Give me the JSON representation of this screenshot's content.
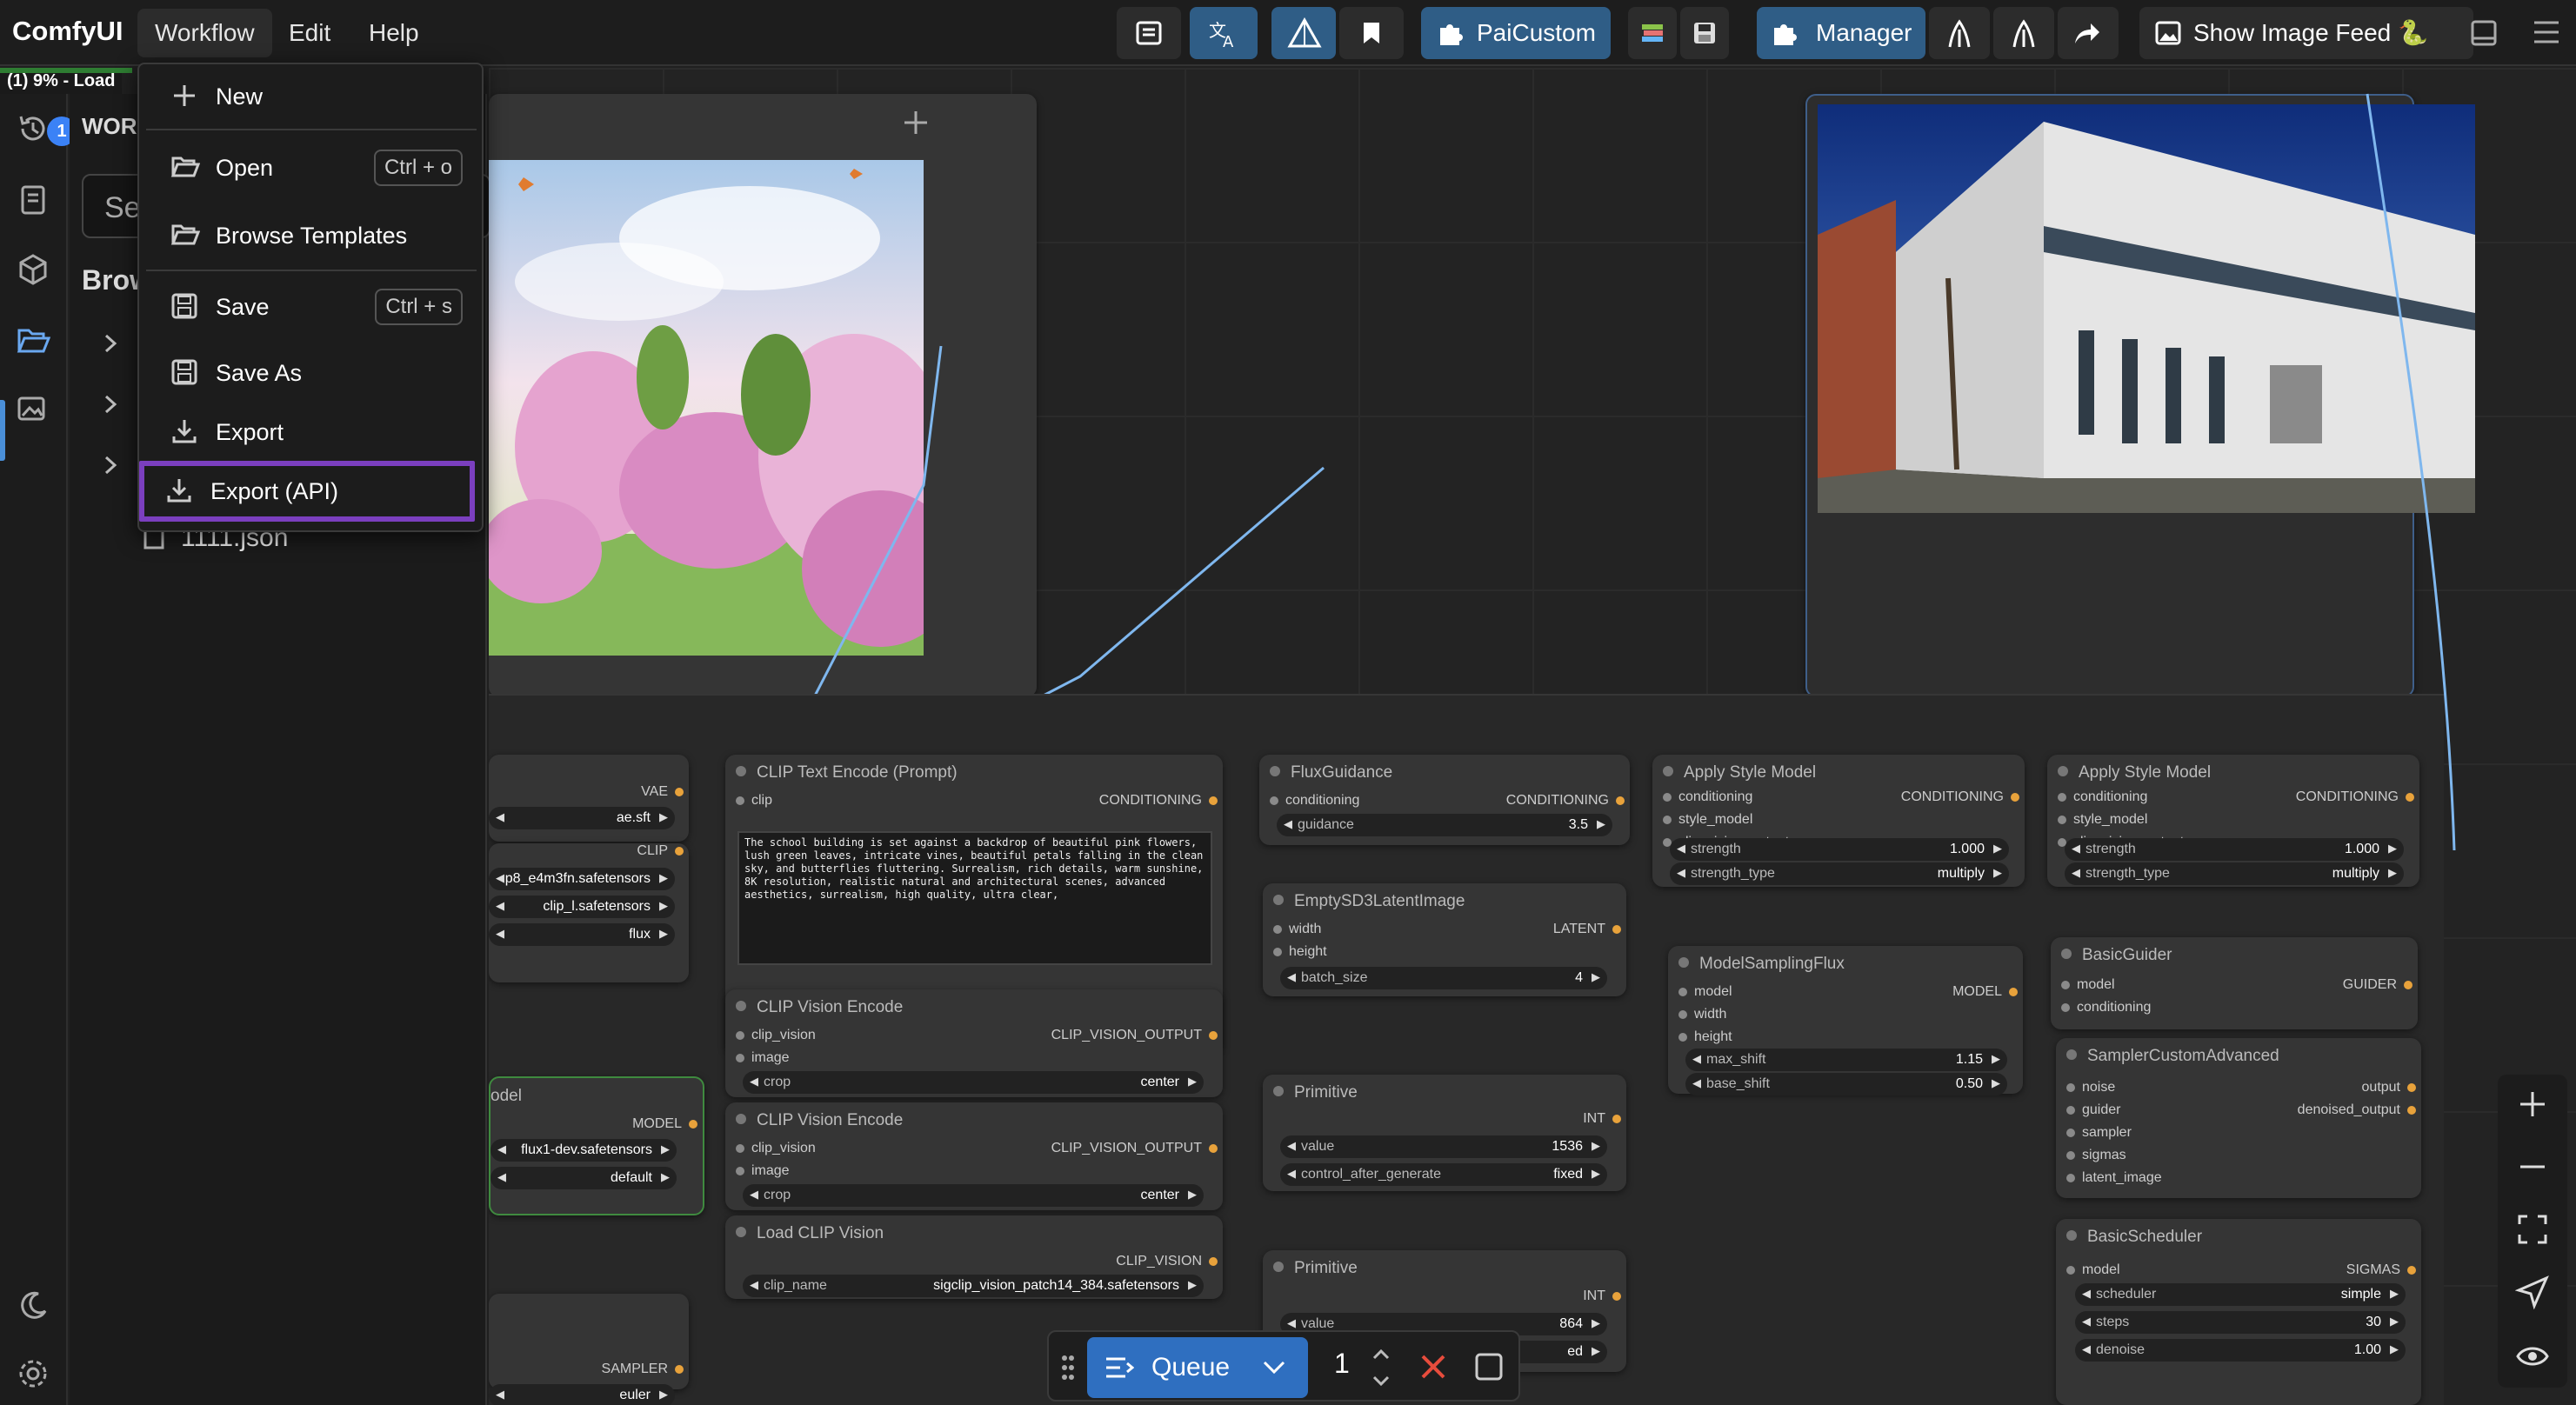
{
  "app": {
    "logo": "ComfyUI"
  },
  "menubar": {
    "workflow": "Workflow",
    "edit": "Edit",
    "help": "Help"
  },
  "toolbar": {
    "paicustom": "PaiCustom",
    "manager": "Manager",
    "show_image_feed": "Show Image Feed 🐍"
  },
  "status": {
    "load": "(1) 9% - Load"
  },
  "sidebar": {
    "queue_badge": "1",
    "panel_title": "WORK",
    "search_placeholder": "Se",
    "browse": "Brow",
    "file": "1111.json"
  },
  "workflow_menu": {
    "items": [
      {
        "label": "New",
        "shortcut": ""
      },
      {
        "label": "Open",
        "shortcut": "Ctrl + o"
      },
      {
        "label": "Browse Templates",
        "shortcut": ""
      },
      {
        "label": "Save",
        "shortcut": "Ctrl + s"
      },
      {
        "label": "Save As",
        "shortcut": ""
      },
      {
        "label": "Export",
        "shortcut": ""
      },
      {
        "label": "Export (API)",
        "shortcut": ""
      }
    ]
  },
  "nodes": {
    "vae_loader": {
      "slot_vae": "VAE",
      "vae_name": "ae.sft"
    },
    "clip_loader": {
      "slot_clip": "CLIP",
      "clip1": "p8_e4m3fn.safetensors",
      "clip2": "clip_l.safetensors",
      "type": "flux"
    },
    "unet_loader": {
      "title_frag": "odel",
      "slot_model": "MODEL",
      "unet": "flux1-dev.safetensors",
      "dtype": "default"
    },
    "sampler_select": {
      "slot_sampler": "SAMPLER",
      "sampler": "euler"
    },
    "clip_text_encode": {
      "title": "CLIP Text Encode (Prompt)",
      "in_clip": "clip",
      "out": "CONDITIONING",
      "text": "The school building is set against a backdrop of beautiful pink flowers, lush green leaves, intricate vines, beautiful petals falling in the clean sky, and butterflies fluttering. Surrealism, rich details, warm sunshine, 8K resolution, realistic natural and architectural scenes, advanced aesthetics, surrealism, high quality, ultra clear,"
    },
    "clip_vision_encode_1": {
      "title": "CLIP Vision Encode",
      "in1": "clip_vision",
      "in2": "image",
      "out": "CLIP_VISION_OUTPUT",
      "crop_label": "crop",
      "crop": "center"
    },
    "clip_vision_encode_2": {
      "title": "CLIP Vision Encode",
      "in1": "clip_vision",
      "in2": "image",
      "out": "CLIP_VISION_OUTPUT",
      "crop_label": "crop",
      "crop": "center"
    },
    "load_clip_vision": {
      "title": "Load CLIP Vision",
      "out": "CLIP_VISION",
      "label": "clip_name",
      "value": "sigclip_vision_patch14_384.safetensors"
    },
    "flux_guidance": {
      "title": "FluxGuidance",
      "in": "conditioning",
      "out": "CONDITIONING",
      "label": "guidance",
      "value": "3.5"
    },
    "empty_latent": {
      "title": "EmptySD3LatentImage",
      "in1": "width",
      "in2": "height",
      "out": "LATENT",
      "label": "batch_size",
      "value": "4"
    },
    "primitive_1": {
      "title": "Primitive",
      "out": "INT",
      "l1": "value",
      "v1": "1536",
      "l2": "control_after_generate",
      "v2": "fixed"
    },
    "primitive_2": {
      "title": "Primitive",
      "out": "INT",
      "l1": "value",
      "v1": "864",
      "v2_frag": "ed"
    },
    "apply_style_1": {
      "title": "Apply Style Model",
      "in1": "conditioning",
      "in2": "style_model",
      "in3": "clip_vision_output",
      "out": "CONDITIONING",
      "l1": "strength",
      "v1": "1.000",
      "l2": "strength_type",
      "v2": "multiply"
    },
    "apply_style_2": {
      "title": "Apply Style Model",
      "in1": "conditioning",
      "in2": "style_model",
      "in3": "clip_vision_output",
      "out": "CONDITIONING",
      "l1": "strength",
      "v1": "1.000",
      "l2": "strength_type",
      "v2": "multiply"
    },
    "model_sampling_flux": {
      "title": "ModelSamplingFlux",
      "in1": "model",
      "in2": "width",
      "in3": "height",
      "out": "MODEL",
      "l1": "max_shift",
      "v1": "1.15",
      "l2": "base_shift",
      "v2": "0.50"
    },
    "basic_guider": {
      "title": "BasicGuider",
      "in1": "model",
      "in2": "conditioning",
      "out": "GUIDER"
    },
    "sampler_custom_adv": {
      "title": "SamplerCustomAdvanced",
      "in1": "noise",
      "in2": "guider",
      "in3": "sampler",
      "in4": "sigmas",
      "in5": "latent_image",
      "out1": "output",
      "out2": "denoised_output"
    },
    "basic_scheduler": {
      "title": "BasicScheduler",
      "in1": "model",
      "out": "SIGMAS",
      "l1": "scheduler",
      "v1": "simple",
      "l2": "steps",
      "v2": "30",
      "l3": "denoise",
      "v3": "1.00"
    }
  },
  "queue": {
    "label": "Queue",
    "count": "1"
  },
  "colors": {
    "accent": "#2f6fc0",
    "highlight_border": "#7b3fbf",
    "panel": "#353535",
    "canvas": "#232323"
  }
}
